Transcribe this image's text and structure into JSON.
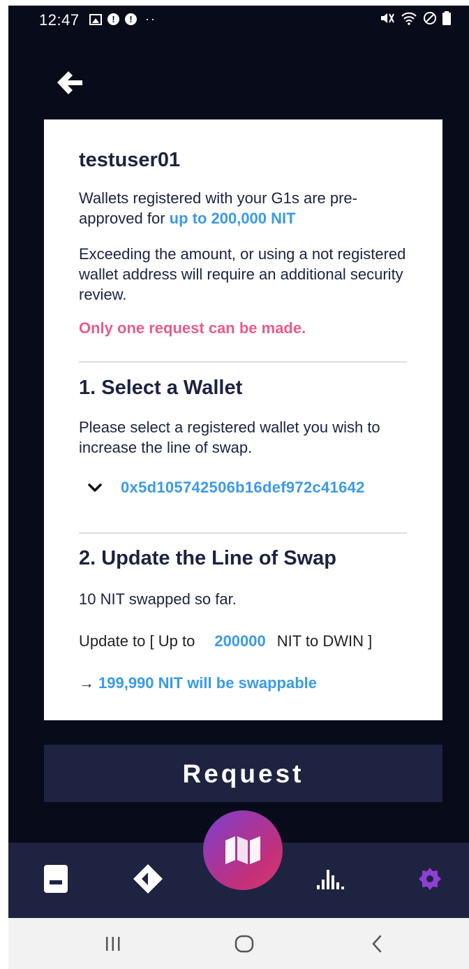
{
  "status_bar": {
    "time": "12:47",
    "left_icons": [
      "image-icon",
      "alert-icon",
      "alert-icon"
    ],
    "dots": "··",
    "right_icons": [
      "mute-icon",
      "wifi-icon",
      "dnd-icon",
      "battery-icon"
    ],
    "alert_glyph": "!"
  },
  "header": {
    "back_icon": "back-arrow-icon"
  },
  "card": {
    "username": "testuser01",
    "preapproved_text": "Wallets registered with your G1s are pre-approved for ",
    "preapproved_amount": "up to 200,000 NIT",
    "exceed_text": "Exceeding the amount, or using a not registered wallet address will require an additional security review.",
    "warning": "Only one request can be made.",
    "section1": {
      "title": "1. Select a Wallet",
      "description": "Please select a registered wallet you wish to increase the line of swap.",
      "wallet_address": "0x5d105742506b16def972c41642"
    },
    "section2": {
      "title": "2. Update the Line of Swap",
      "swapped_so_far": "10 NIT swapped so far.",
      "update_prefix": "Update to [ Up to",
      "update_value": "200000",
      "update_suffix": "NIT to DWIN ]",
      "swappable_arrow": "→",
      "swappable_text": "199,990 NIT will be swappable"
    }
  },
  "request_button": {
    "label": "Request"
  },
  "tab_bar": {
    "tabs": [
      "wallet-icon",
      "diamond-icon",
      "map-icon",
      "chart-icon",
      "settings-icon"
    ],
    "active": "settings-icon"
  },
  "nav_bar": [
    "recent-apps-icon",
    "home-icon",
    "back-icon"
  ],
  "colors": {
    "background": "#070b1a",
    "accent_blue": "#3b9ae8",
    "warning_pink": "#e95c8a",
    "button_navy": "#1d2340",
    "active_tab": "#8e3fd4"
  }
}
